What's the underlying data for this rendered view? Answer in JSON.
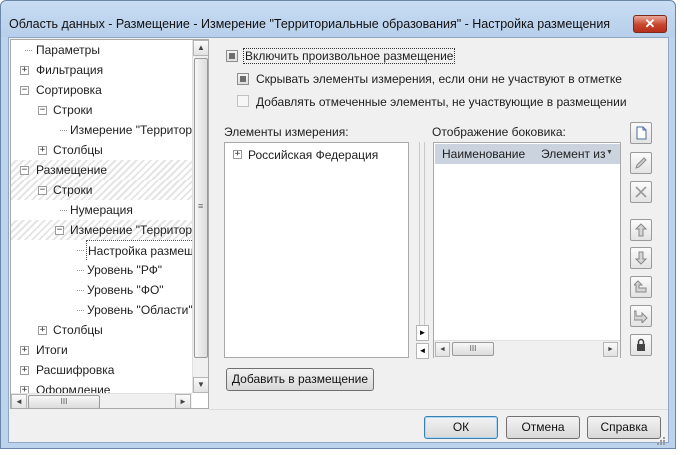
{
  "window": {
    "title": "Область данных - Размещение - Измерение \"Территориальные образования\" - Настройка размещения",
    "close_glyph": "✕"
  },
  "tree": {
    "items": [
      {
        "label": "Параметры",
        "expander": ""
      },
      {
        "label": "Фильтрация",
        "expander": "+"
      },
      {
        "label": "Сортировка",
        "expander": "−"
      },
      {
        "label": "Строки",
        "expander": "−"
      },
      {
        "label": "Измерение \"Территориальные образования\"",
        "expander": ""
      },
      {
        "label": "Столбцы",
        "expander": "+"
      },
      {
        "label": "Размещение",
        "expander": "−"
      },
      {
        "label": "Строки",
        "expander": "−"
      },
      {
        "label": "Нумерация",
        "expander": ""
      },
      {
        "label": "Измерение \"Территориальные образования\"",
        "expander": "−"
      },
      {
        "label": "Настройка размещения",
        "expander": ""
      },
      {
        "label": "Уровень \"РФ\"",
        "expander": ""
      },
      {
        "label": "Уровень \"ФО\"",
        "expander": ""
      },
      {
        "label": "Уровень \"Области\"",
        "expander": ""
      },
      {
        "label": "Столбцы",
        "expander": "+"
      },
      {
        "label": "Итоги",
        "expander": "+"
      },
      {
        "label": "Расшифровка",
        "expander": "+"
      },
      {
        "label": "Оформление",
        "expander": "+"
      }
    ],
    "scroll_up": "▲",
    "scroll_down": "▼",
    "scroll_left": "◄",
    "scroll_right": "►",
    "thumb_grip": "≡",
    "hthumb_grip": "III"
  },
  "options": {
    "enable_custom": "Включить произвольное размещение",
    "hide_elements": "Скрывать элементы измерения, если они не участвуют в отметке",
    "add_marked": "Добавлять отмеченные элементы, не участвующие в размещении"
  },
  "elements": {
    "label": "Элементы измерения:",
    "root_item": "Российская Федерация",
    "root_expander": "+"
  },
  "sidebar_view": {
    "label": "Отображение боковика:",
    "columns": [
      "Наименование",
      "Элемент из"
    ],
    "dropdown_glyph": "▼",
    "hthumb_grip": "III"
  },
  "transfer": {
    "right_arrow": "►",
    "left_arrow": "◄"
  },
  "buttons": {
    "add_to_placement": "Добавить в размещение",
    "ok": "ОК",
    "cancel": "Отмена",
    "help": "Справка"
  },
  "toolbar_icons": [
    "new-document-icon",
    "edit-pencil-icon",
    "delete-cross-icon",
    "move-up-icon",
    "move-down-icon",
    "level-up-icon",
    "level-down-icon",
    "lock-icon"
  ]
}
